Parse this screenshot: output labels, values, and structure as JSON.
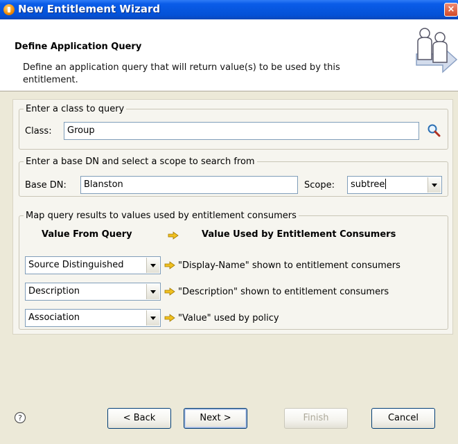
{
  "window": {
    "title": "New Entitlement Wizard",
    "close_label": "×"
  },
  "header": {
    "title": "Define Application Query",
    "description": "Define an application query that will return value(s) to be used by this entitlement."
  },
  "class_group": {
    "legend": "Enter a class to query",
    "label": "Class:",
    "value": "Group",
    "search_icon": "magnifier-icon"
  },
  "basedn_group": {
    "legend": "Enter a base DN and select a scope to search from",
    "basedn_label": "Base DN:",
    "basedn_value": "Blanston",
    "scope_label": "Scope:",
    "scope_value": "subtree"
  },
  "mapping_group": {
    "legend": "Map query results to values used by entitlement consumers",
    "col_from": "Value From Query",
    "col_to": "Value Used by Entitlement Consumers",
    "rows": [
      {
        "select": "Source Distinguished",
        "target": "\"Display-Name\" shown to entitlement consumers"
      },
      {
        "select": "Description",
        "target": "\"Description\" shown to entitlement consumers"
      },
      {
        "select": "Association",
        "target": "\"Value\" used by policy"
      }
    ]
  },
  "footer": {
    "back_label": "< Back",
    "next_label": "Next >",
    "finish_label": "Finish",
    "cancel_label": "Cancel",
    "help_icon": "help-icon"
  },
  "colors": {
    "title_bar": "#0451d6",
    "arrow": "#f0c020"
  }
}
